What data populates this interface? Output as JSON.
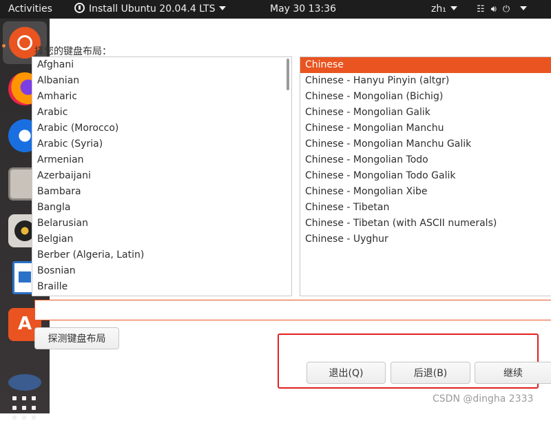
{
  "topbar": {
    "activities": "Activities",
    "app_menu": "Install Ubuntu 20.04.4 LTS",
    "clock": "May 30  13:36",
    "language": "zh₁",
    "network_icon": "network-icon",
    "volume_icon": "volume-icon",
    "power_icon": "power-icon"
  },
  "dock": {
    "apps": [
      "ubuntu-installer-icon",
      "firefox-icon",
      "thunderbird-icon",
      "files-icon",
      "rhythmbox-icon",
      "libreoffice-writer-icon",
      "ubuntu-software-icon",
      "help-icon"
    ],
    "show_apps_icon": "apps-grid-icon"
  },
  "installer": {
    "prompt": "择您的键盘布局：",
    "layouts": [
      "Afghani",
      "Albanian",
      "Amharic",
      "Arabic",
      "Arabic (Morocco)",
      "Arabic (Syria)",
      "Armenian",
      "Azerbaijani",
      "Bambara",
      "Bangla",
      "Belarusian",
      "Belgian",
      "Berber (Algeria, Latin)",
      "Bosnian",
      "Braille"
    ],
    "variants": [
      "Chinese",
      "Chinese - Hanyu Pinyin (altgr)",
      "Chinese - Mongolian (Bichig)",
      "Chinese - Mongolian Galik",
      "Chinese - Mongolian Manchu",
      "Chinese - Mongolian Manchu Galik",
      "Chinese - Mongolian Todo",
      "Chinese - Mongolian Todo Galik",
      "Chinese - Mongolian Xibe",
      "Chinese - Tibetan",
      "Chinese - Tibetan (with ASCII numerals)",
      "Chinese - Uyghur"
    ],
    "selected_variant": "Chinese",
    "test_input_value": "",
    "detect_button": "探测键盘布局",
    "quit_button": "退出(Q)",
    "back_button": "后退(B)",
    "continue_button": "继续"
  },
  "watermark": "CSDN @dingha 2333",
  "colors": {
    "accent": "#e95420",
    "highlight": "#e02020",
    "topbar": "#1d1d1d"
  }
}
